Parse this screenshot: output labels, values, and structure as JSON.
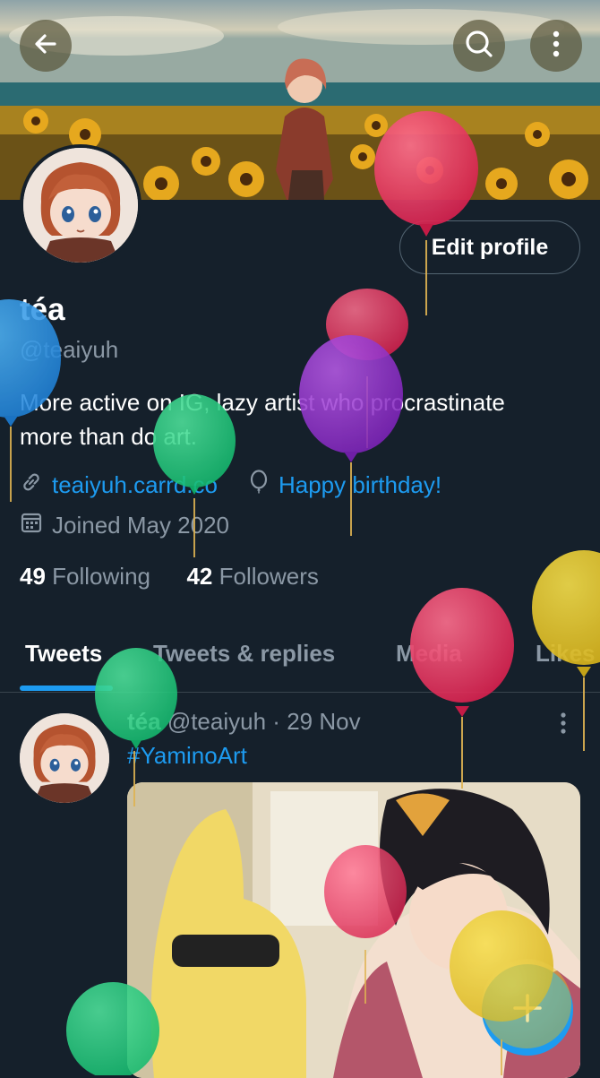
{
  "header": {
    "back_icon": "arrow-left-icon",
    "search_icon": "search-icon",
    "more_icon": "more-vertical-icon"
  },
  "profile": {
    "edit_button": "Edit profile",
    "name": "téa",
    "handle": "@teaiyuh",
    "bio_line1": "More active on IG, lazy artist who procrastinate",
    "bio_line2": "more than do art.",
    "website": "teaiyuh.carrd.co",
    "birthday": "Happy birthday!",
    "joined": "Joined May 2020",
    "following_count": "49",
    "following_label": "Following",
    "followers_count": "42",
    "followers_label": "Followers"
  },
  "tabs": [
    {
      "label": "Tweets",
      "active": true
    },
    {
      "label": "Tweets & replies",
      "active": false
    },
    {
      "label": "Media",
      "active": false
    },
    {
      "label": "Likes",
      "active": false
    }
  ],
  "tweet": {
    "name": "téa",
    "handle": "@teaiyuh",
    "separator": "·",
    "date": "29 Nov",
    "text": "#YaminoArt"
  },
  "fab": {
    "icon": "plus-icon"
  },
  "colors": {
    "background": "#15202b",
    "accent": "#1d9bf0",
    "secondary_text": "#8b98a5",
    "border": "#38444d"
  },
  "balloons": [
    "pink",
    "red",
    "purple",
    "blue",
    "green",
    "pink",
    "yellow",
    "green",
    "red",
    "yellow",
    "green"
  ]
}
